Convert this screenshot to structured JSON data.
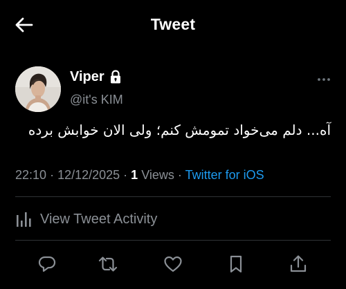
{
  "header": {
    "title": "Tweet",
    "back_icon": "arrow-left-icon"
  },
  "author": {
    "display_name": "Viper",
    "handle": "@it's KIM",
    "protected_icon": "lock-icon"
  },
  "tweet": {
    "text": "آه... دلم می‌خواد تمومش کنم؛ ولی الان خوابش برده",
    "time": "22:10",
    "date": "12/12/2025",
    "views_count": "1",
    "views_label": "Views",
    "source": "Twitter for iOS"
  },
  "activity": {
    "label": "View Tweet Activity",
    "icon": "bar-chart-icon"
  },
  "actions": {
    "icons": [
      "reply-icon",
      "retweet-icon",
      "like-icon",
      "bookmark-icon",
      "share-icon"
    ]
  },
  "colors": {
    "background": "#000000",
    "text": "#ffffff",
    "muted": "#8b9096",
    "accent": "#1d9bf0",
    "divider": "#2f3336"
  }
}
